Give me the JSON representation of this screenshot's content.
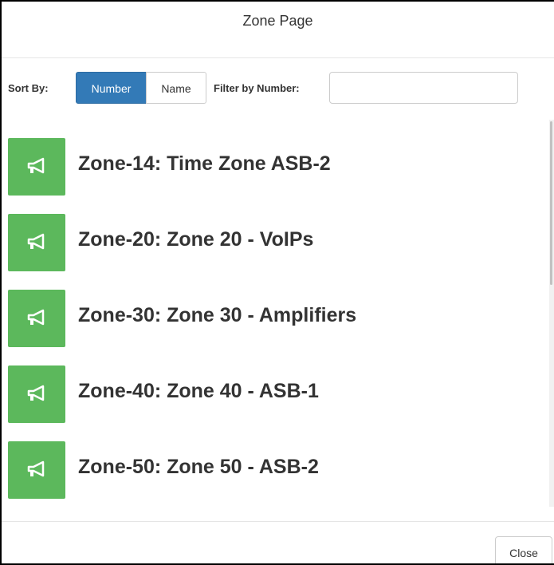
{
  "header": {
    "title": "Zone Page"
  },
  "toolbar": {
    "sort_label": "Sort By:",
    "sort_options": [
      {
        "label": "Number",
        "active": true
      },
      {
        "label": "Name",
        "active": false
      }
    ],
    "filter_label": "Filter by Number:",
    "filter_value": "",
    "filter_placeholder": ""
  },
  "zones": [
    {
      "label": "Zone-14: Time Zone ASB-2",
      "icon": "megaphone-icon"
    },
    {
      "label": "Zone-20: Zone 20 - VoIPs",
      "icon": "megaphone-icon"
    },
    {
      "label": "Zone-30: Zone 30 - Amplifiers",
      "icon": "megaphone-icon"
    },
    {
      "label": "Zone-40: Zone 40 - ASB-1",
      "icon": "megaphone-icon"
    },
    {
      "label": "Zone-50: Zone 50 - ASB-2",
      "icon": "megaphone-icon"
    }
  ],
  "footer": {
    "close_label": "Close"
  },
  "colors": {
    "active_button": "#337ab7",
    "zone_icon_background": "#5cb85c"
  }
}
